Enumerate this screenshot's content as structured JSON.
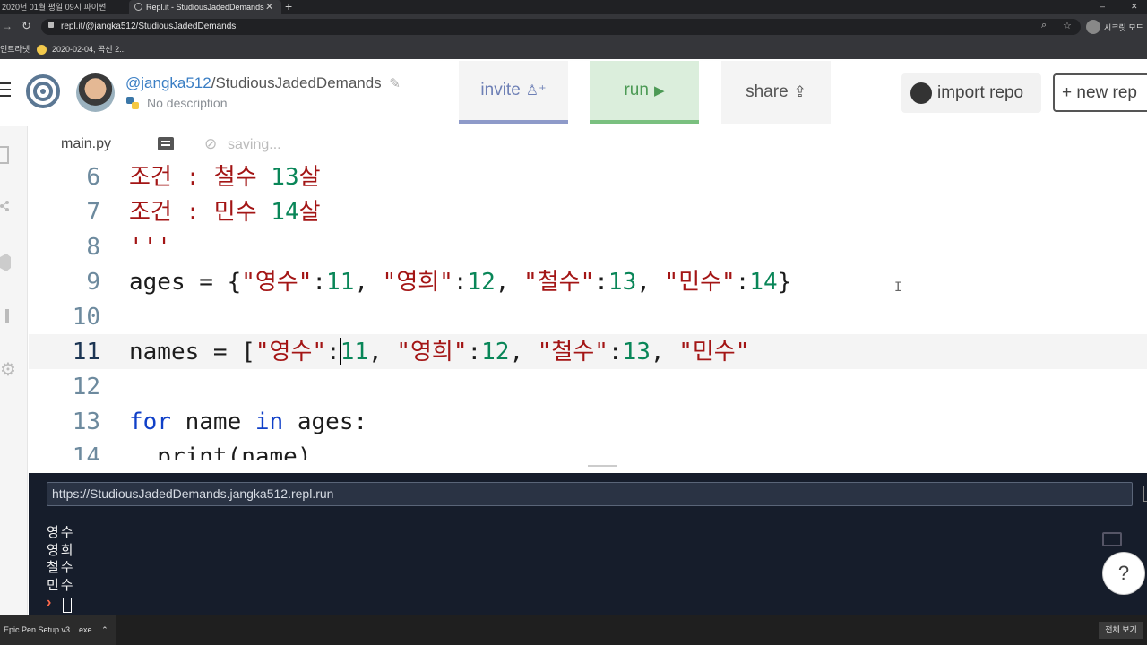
{
  "browser": {
    "tabs": [
      {
        "label": "2020년 01월 평일 09시 파이썬"
      },
      {
        "label": "Repl.it - StudiousJadedDemands"
      }
    ],
    "new_tab": "+",
    "address": "repl.it/@jangka512/StudiousJadedDemands",
    "profile_label": "시크릿 모드",
    "bookmarks": [
      {
        "label": "인트라넷"
      },
      {
        "label": "2020-02-04, 곡선 2..."
      }
    ]
  },
  "header": {
    "owner": "@jangka512",
    "separator": "/",
    "repl_name": "StudiousJadedDemands",
    "description": "No description",
    "invite_label": "invite",
    "run_label": "run",
    "share_label": "share",
    "import_label": "import repo",
    "new_repl_label": "+ new rep",
    "colors": {
      "invite_accent": "#8e9ac9",
      "run_accent": "#7ac07f",
      "run_bg": "#dbeedc"
    }
  },
  "editor": {
    "file_tab": "main.py",
    "status": "saving...",
    "lines": [
      {
        "num": "6",
        "tokens": [
          {
            "t": "str",
            "v": "조건 : 철수 "
          },
          {
            "t": "num",
            "v": "13"
          },
          {
            "t": "str",
            "v": "살"
          }
        ]
      },
      {
        "num": "7",
        "tokens": [
          {
            "t": "str",
            "v": "조건 : 민수 "
          },
          {
            "t": "num",
            "v": "14"
          },
          {
            "t": "str",
            "v": "살"
          }
        ]
      },
      {
        "num": "8",
        "tokens": [
          {
            "t": "str",
            "v": "'''"
          }
        ]
      },
      {
        "num": "9",
        "tokens": [
          {
            "t": "plain",
            "v": "ages = {"
          },
          {
            "t": "str",
            "v": "\"영수\""
          },
          {
            "t": "plain",
            "v": ":"
          },
          {
            "t": "num",
            "v": "11"
          },
          {
            "t": "plain",
            "v": ", "
          },
          {
            "t": "str",
            "v": "\"영희\""
          },
          {
            "t": "plain",
            "v": ":"
          },
          {
            "t": "num",
            "v": "12"
          },
          {
            "t": "plain",
            "v": ", "
          },
          {
            "t": "str",
            "v": "\"철수\""
          },
          {
            "t": "plain",
            "v": ":"
          },
          {
            "t": "num",
            "v": "13"
          },
          {
            "t": "plain",
            "v": ", "
          },
          {
            "t": "str",
            "v": "\"민수\""
          },
          {
            "t": "plain",
            "v": ":"
          },
          {
            "t": "num",
            "v": "14"
          },
          {
            "t": "plain",
            "v": "}"
          }
        ]
      },
      {
        "num": "10",
        "tokens": []
      },
      {
        "num": "11",
        "tokens": [
          {
            "t": "plain",
            "v": "names = ["
          },
          {
            "t": "str",
            "v": "\"영수\""
          },
          {
            "t": "plain",
            "v": ":"
          },
          {
            "t": "num",
            "v": "11"
          },
          {
            "t": "plain",
            "v": ", "
          },
          {
            "t": "str",
            "v": "\"영희\""
          },
          {
            "t": "plain",
            "v": ":"
          },
          {
            "t": "num",
            "v": "12"
          },
          {
            "t": "plain",
            "v": ", "
          },
          {
            "t": "str",
            "v": "\"철수\""
          },
          {
            "t": "plain",
            "v": ":"
          },
          {
            "t": "num",
            "v": "13"
          },
          {
            "t": "plain",
            "v": ", "
          },
          {
            "t": "str",
            "v": "\"민수\""
          }
        ]
      },
      {
        "num": "12",
        "tokens": []
      },
      {
        "num": "13",
        "tokens": [
          {
            "t": "kw",
            "v": "for"
          },
          {
            "t": "plain",
            "v": " name "
          },
          {
            "t": "kw",
            "v": "in"
          },
          {
            "t": "plain",
            "v": " ages:"
          }
        ]
      },
      {
        "num": "14",
        "tokens": [
          {
            "t": "plain",
            "v": "  print(name)"
          }
        ]
      }
    ],
    "colors": {
      "string": "#a31515",
      "number": "#098658",
      "keyword": "#1040c8",
      "line_number": "#6d8a9e",
      "active_line_number": "#1c3553"
    }
  },
  "console": {
    "url": "https://StudiousJadedDemands.jangka512.repl.run",
    "output": [
      "영수",
      "영희",
      "철수",
      "민수"
    ],
    "prompt": "›",
    "help_label": "?"
  },
  "taskbar": {
    "item": "Epic Pen Setup v3....exe",
    "right_label": "전체 보기"
  }
}
